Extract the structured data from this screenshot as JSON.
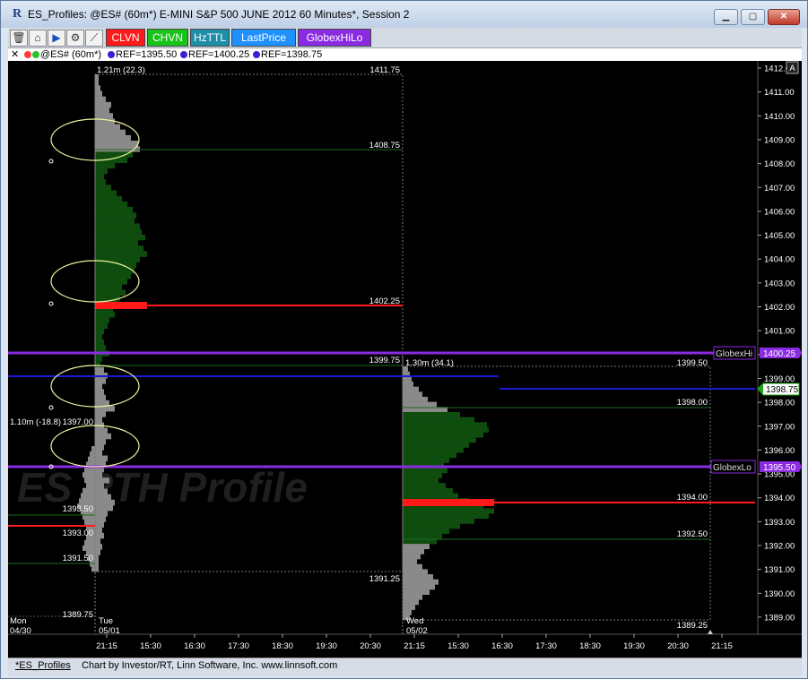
{
  "window": {
    "title": "ES_Profiles: @ES# (60m*) E-MINI S&P 500 JUNE 2012 60 Minutes*, Session 2",
    "icon": "R"
  },
  "toolbar": {
    "icons": [
      "trash-icon",
      "home-icon",
      "play-icon",
      "gear-icon",
      "ruler-icon"
    ],
    "buttons": [
      {
        "label": "CLVN",
        "color": "#ff1a1a"
      },
      {
        "label": "CHVN",
        "color": "#19c219"
      },
      {
        "label": "HzTTL",
        "color": "#1f8fa8"
      },
      {
        "label": "LastPrice",
        "color": "#1e90ff"
      },
      {
        "label": "GlobexHiLo",
        "color": "#8a2be2"
      }
    ]
  },
  "legend": {
    "symbol": "@ES# (60m*)",
    "refs": [
      {
        "label": "REF=1395.50",
        "color": "#3b1fd6"
      },
      {
        "label": "REF=1400.25",
        "color": "#3b1fd6"
      },
      {
        "label": "REF=1398.75",
        "color": "#3b1fd6"
      }
    ]
  },
  "chart": {
    "watermark": "ES   RTH Profile",
    "price_axis": [
      "1412.00",
      "1411.00",
      "1410.00",
      "1409.00",
      "1408.00",
      "1407.00",
      "1406.00",
      "1405.00",
      "1404.00",
      "1403.00",
      "1402.00",
      "1401.00",
      "1400.00",
      "1399.00",
      "1398.00",
      "1397.00",
      "1396.00",
      "1395.00",
      "1394.00",
      "1393.00",
      "1392.00",
      "1391.00",
      "1390.00",
      "1389.00"
    ],
    "axis_letter": "A",
    "last_price": "1398.75",
    "globex_hi": {
      "label": "GlobexHi",
      "value": "1400.25",
      "color": "#8a2be2"
    },
    "globex_lo": {
      "label": "GlobexLo",
      "value": "1395.50",
      "color": "#8a2be2"
    },
    "time_axis": [
      "21:15",
      "15:30",
      "16:30",
      "17:30",
      "18:30",
      "19:30",
      "20:30",
      "21:15",
      "15:30",
      "16:30",
      "17:30",
      "18:30",
      "19:30",
      "20:30",
      "21:15"
    ],
    "sessions": [
      {
        "day": "Mon",
        "date": "04/30"
      },
      {
        "day": "Tue",
        "date": "05/01"
      },
      {
        "day": "Wed",
        "date": "05/02"
      }
    ],
    "labels": {
      "mon_low": "1389.75",
      "mon_poc_note": "1.10m (-18.8)",
      "mon_1397": "1397.00",
      "mon_1393_50": "1393.50",
      "mon_1393": "1393.00",
      "mon_1391_50": "1391.50",
      "tue_header": "1.21m (22.3)",
      "tue_high": "1411.75",
      "tue_1408_75": "1408.75",
      "tue_poc": "1402.25",
      "tue_1399_75": "1399.75",
      "tue_low": "1391.25",
      "wed_header": "1.30m (34.1)",
      "wed_high": "1399.50",
      "wed_1398": "1398.00",
      "wed_poc": "1394.00",
      "wed_1392_50": "1392.50",
      "wed_low": "1389.25"
    }
  },
  "status": {
    "tab": "*ES_Profiles",
    "credit": "Chart by Investor/RT, Linn Software, Inc. www.linnsoft.com"
  }
}
